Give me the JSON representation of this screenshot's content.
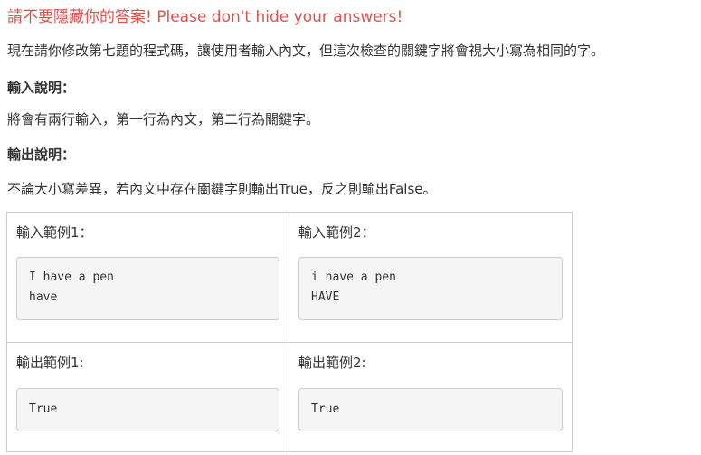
{
  "warning": "請不要隱藏你的答案! Please don't hide your answers!",
  "description": "現在請你修改第七題的程式碼，讓使用者輸入內文，但這次檢查的關鍵字將會視大小寫為相同的字。",
  "input_heading": "輸入說明：",
  "input_description": "將會有兩行輸入，第一行為內文，第二行為關鍵字。",
  "output_heading": "輸出說明：",
  "output_description": "不論大小寫差異，若內文中存在關鍵字則輸出True，反之則輸出False。",
  "examples": {
    "input1_title": "輸入範例1：",
    "input1_code": "I have a pen\nhave",
    "input2_title": "輸入範例2：",
    "input2_code": "i have a pen\nHAVE",
    "output1_title": "輸出範例1:",
    "output1_code": "True",
    "output2_title": "輸出範例2:",
    "output2_code": "True"
  },
  "colors": {
    "warning": "#d9534f",
    "text": "#333333",
    "code_bg": "#f5f5f5",
    "border": "#cccccc"
  }
}
